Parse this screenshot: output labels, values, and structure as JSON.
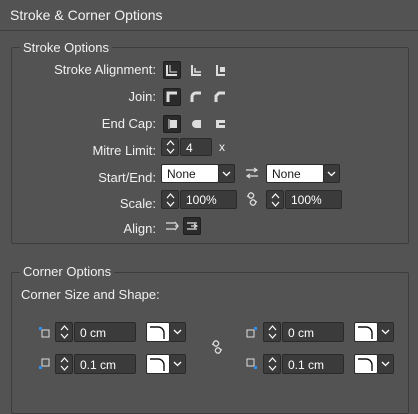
{
  "panel": {
    "title": "Stroke & Corner Options"
  },
  "stroke": {
    "group_title": "Stroke Options",
    "alignment_label": "Stroke Alignment:",
    "join_label": "Join:",
    "endcap_label": "End Cap:",
    "mitre_label": "Mitre Limit:",
    "mitre_value": "4",
    "mitre_suffix": "x",
    "startend_label": "Start/End:",
    "start_value": "None",
    "end_value": "None",
    "scale_label": "Scale:",
    "scale_start": "100%",
    "scale_end": "100%",
    "align_label": "Align:"
  },
  "corner": {
    "group_title": "Corner Options",
    "size_shape_label": "Corner Size and Shape:",
    "top_left_size": "0 cm",
    "top_right_size": "0 cm",
    "bottom_left_size": "0.1 cm",
    "bottom_right_size": "0.1 cm"
  },
  "icons": {
    "alignment": [
      "align-center-icon",
      "align-inside-icon",
      "align-outside-icon"
    ],
    "join": [
      "miter-join-icon",
      "round-join-icon",
      "bevel-join-icon"
    ],
    "endcap": [
      "butt-cap-icon",
      "round-cap-icon",
      "projecting-cap-icon"
    ],
    "accent": "#2f8ff0"
  }
}
